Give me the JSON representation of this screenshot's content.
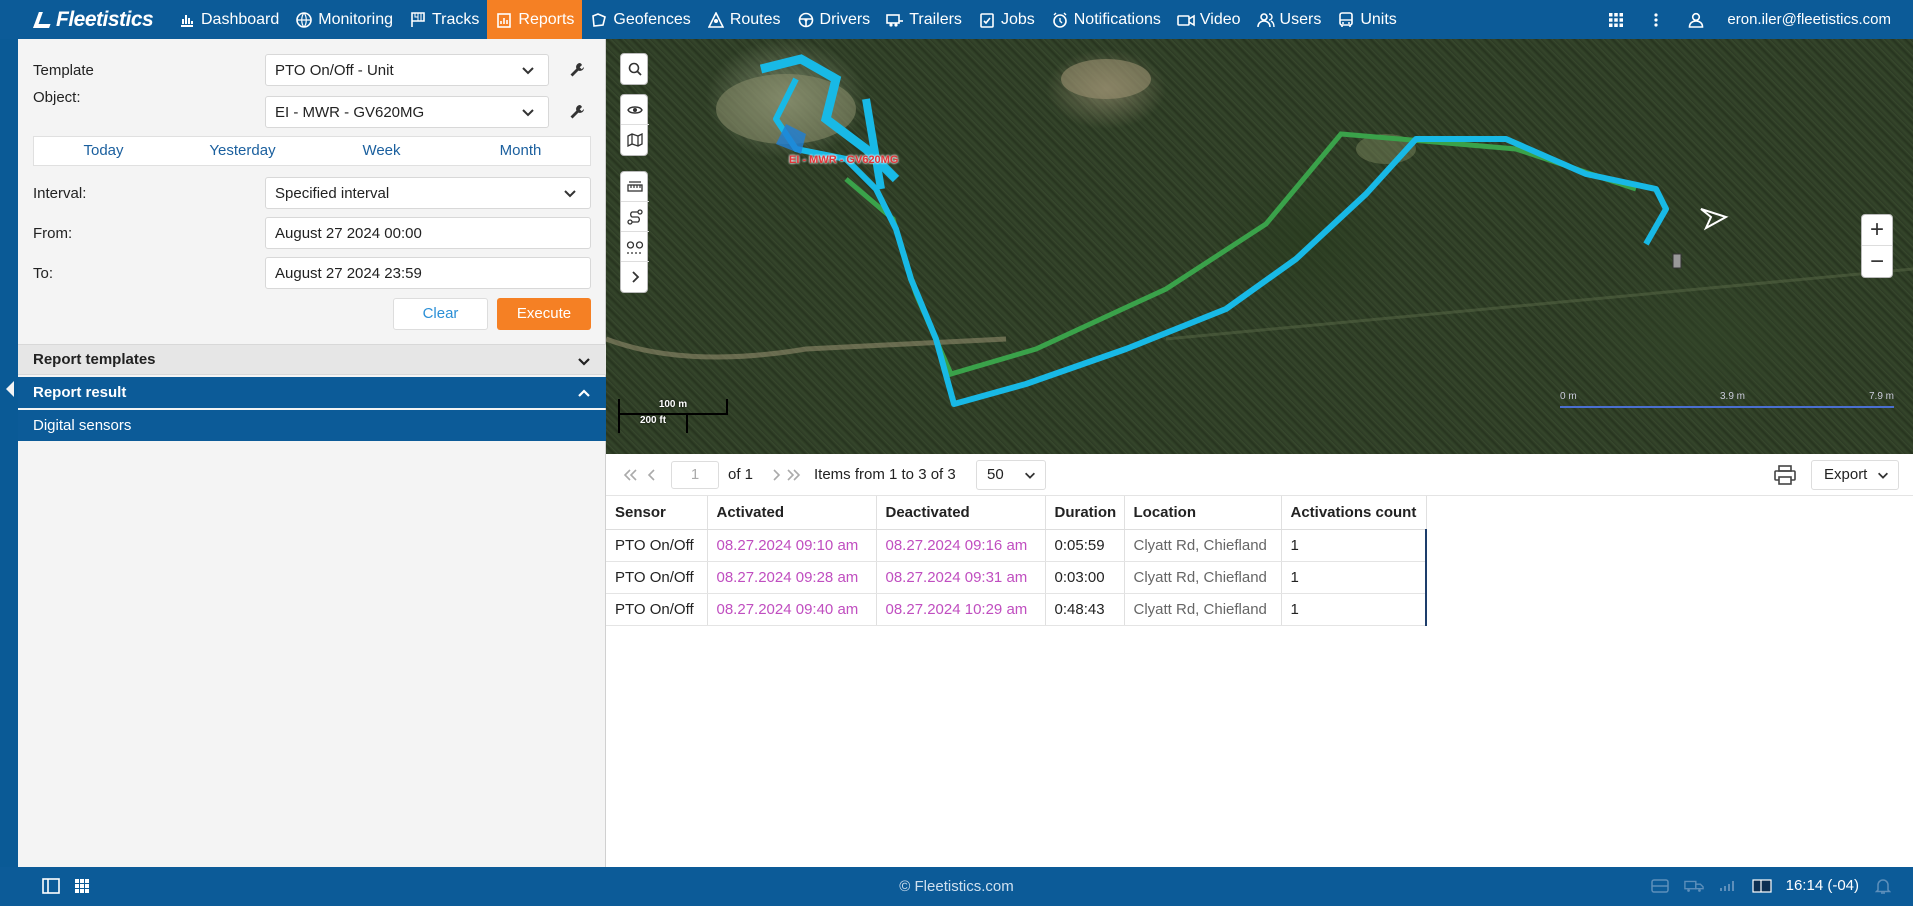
{
  "app": {
    "logo_text": "Fleetistics",
    "brand_color": "#0c5b98",
    "accent_color": "#f58024"
  },
  "nav": {
    "items": [
      {
        "label": "Dashboard",
        "icon": "bar-chart-icon"
      },
      {
        "label": "Monitoring",
        "icon": "globe-icon"
      },
      {
        "label": "Tracks",
        "icon": "flag-icon"
      },
      {
        "label": "Reports",
        "icon": "report-icon",
        "active": true
      },
      {
        "label": "Geofences",
        "icon": "geofence-icon"
      },
      {
        "label": "Routes",
        "icon": "route-icon"
      },
      {
        "label": "Drivers",
        "icon": "steering-wheel-icon"
      },
      {
        "label": "Trailers",
        "icon": "trailer-icon"
      },
      {
        "label": "Jobs",
        "icon": "checklist-icon"
      },
      {
        "label": "Notifications",
        "icon": "alarm-clock-icon"
      },
      {
        "label": "Video",
        "icon": "video-camera-icon"
      },
      {
        "label": "Users",
        "icon": "users-icon"
      },
      {
        "label": "Units",
        "icon": "bus-icon"
      }
    ],
    "user_email": "eron.iler@fleetistics.com"
  },
  "report_form": {
    "template_label": "Template",
    "template_value": "PTO On/Off - Unit",
    "object_label": "Object:",
    "object_value": "EI - MWR - GV620MG",
    "date_tabs": [
      "Today",
      "Yesterday",
      "Week",
      "Month"
    ],
    "interval_label": "Interval:",
    "interval_value": "Specified interval",
    "from_label": "From:",
    "from_value": "August 27 2024 00:00",
    "to_label": "To:",
    "to_value": "August 27 2024 23:59",
    "clear_label": "Clear",
    "execute_label": "Execute"
  },
  "accordion": {
    "templates_label": "Report templates",
    "result_label": "Report result",
    "sensors_label": "Digital sensors"
  },
  "map": {
    "unit_label": "EI - MWR - GV620MG",
    "scale_metric": "100 m",
    "scale_imperial": "200 ft",
    "scale_right_0": "0 m",
    "scale_right_1": "3.9 m",
    "scale_right_2": "7.9 m",
    "zoom_in": "+",
    "zoom_out": "−"
  },
  "pager": {
    "page": "1",
    "of_pages": "of 1",
    "items_text": "Items from 1 to 3 of 3",
    "page_size": "50",
    "export_label": "Export"
  },
  "table": {
    "columns": [
      "Sensor",
      "Activated",
      "Deactivated",
      "Duration",
      "Location",
      "Activations count"
    ],
    "rows": [
      [
        "PTO On/Off",
        "08.27.2024 09:10 am",
        "08.27.2024 09:16 am",
        "0:05:59",
        "Clyatt Rd, Chiefland",
        "1"
      ],
      [
        "PTO On/Off",
        "08.27.2024 09:28 am",
        "08.27.2024 09:31 am",
        "0:03:00",
        "Clyatt Rd, Chiefland",
        "1"
      ],
      [
        "PTO On/Off",
        "08.27.2024 09:40 am",
        "08.27.2024 10:29 am",
        "0:48:43",
        "Clyatt Rd, Chiefland",
        "1"
      ]
    ]
  },
  "footer": {
    "copyright": "© Fleetistics.com",
    "time": "16:14 (-04)"
  }
}
